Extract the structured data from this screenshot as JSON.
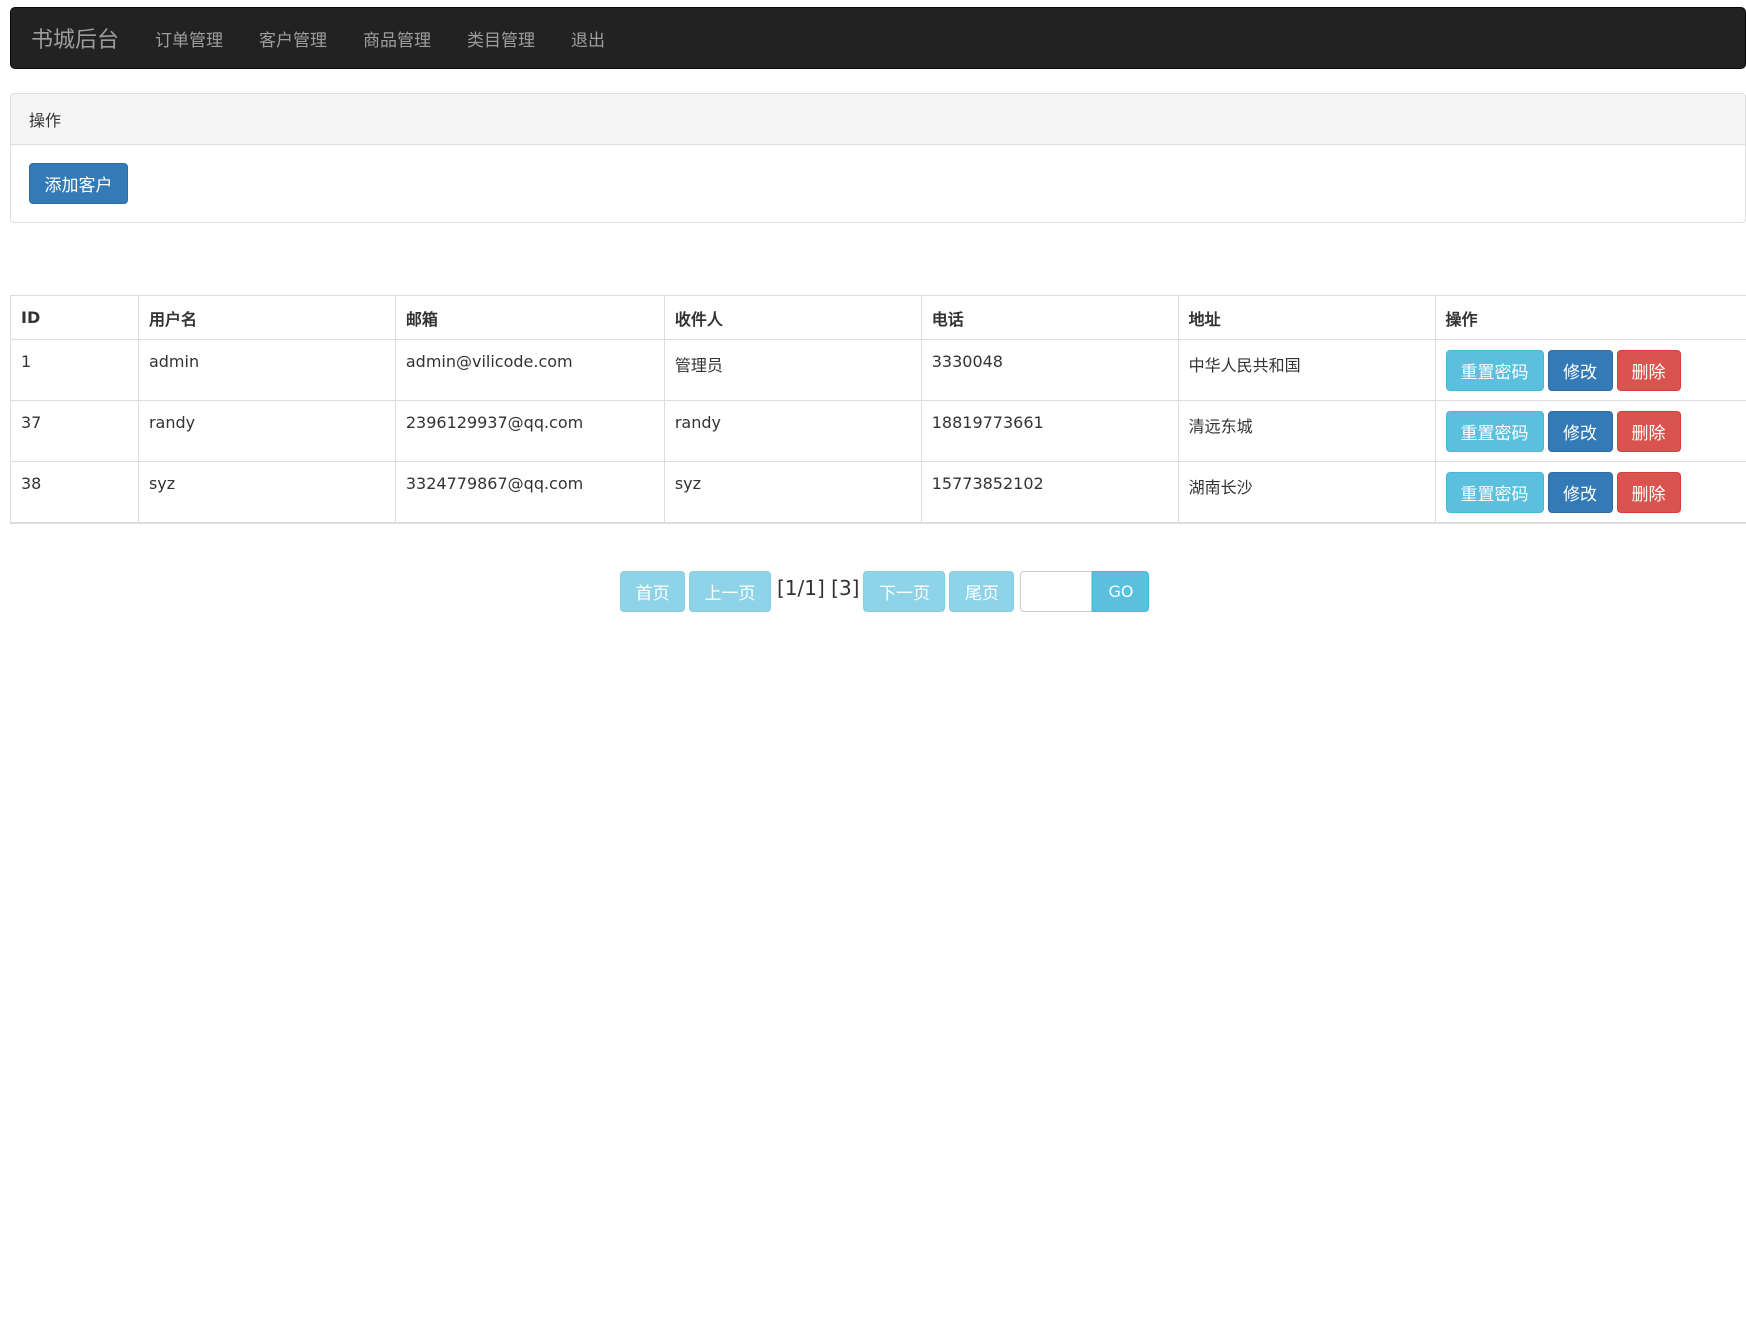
{
  "navbar": {
    "brand": "书城后台",
    "items": [
      "订单管理",
      "客户管理",
      "商品管理",
      "类目管理",
      "退出"
    ]
  },
  "panel": {
    "heading": "操作",
    "add_button": "添加客户"
  },
  "table": {
    "headers": [
      "ID",
      "用户名",
      "邮箱",
      "收件人",
      "电话",
      "地址",
      "操作"
    ],
    "rows": [
      {
        "id": "1",
        "username": "admin",
        "email": "admin@vilicode.com",
        "recipient": "管理员",
        "phone": "3330048",
        "address": "中华人民共和国"
      },
      {
        "id": "37",
        "username": "randy",
        "email": "2396129937@qq.com",
        "recipient": "randy",
        "phone": "18819773661",
        "address": "清远东城"
      },
      {
        "id": "38",
        "username": "syz",
        "email": "3324779867@qq.com",
        "recipient": "syz",
        "phone": "15773852102",
        "address": "湖南长沙"
      }
    ],
    "actions": {
      "reset": "重置密码",
      "edit": "修改",
      "delete": "删除"
    }
  },
  "pagination": {
    "first": "首页",
    "prev": "上一页",
    "info": "[1/1] [3]",
    "next": "下一页",
    "last": "尾页",
    "input_value": "",
    "go": "GO"
  },
  "colors": {
    "navbar_bg": "#222222",
    "primary": "#337ab7",
    "info": "#5bc0de",
    "danger": "#d9534f"
  }
}
